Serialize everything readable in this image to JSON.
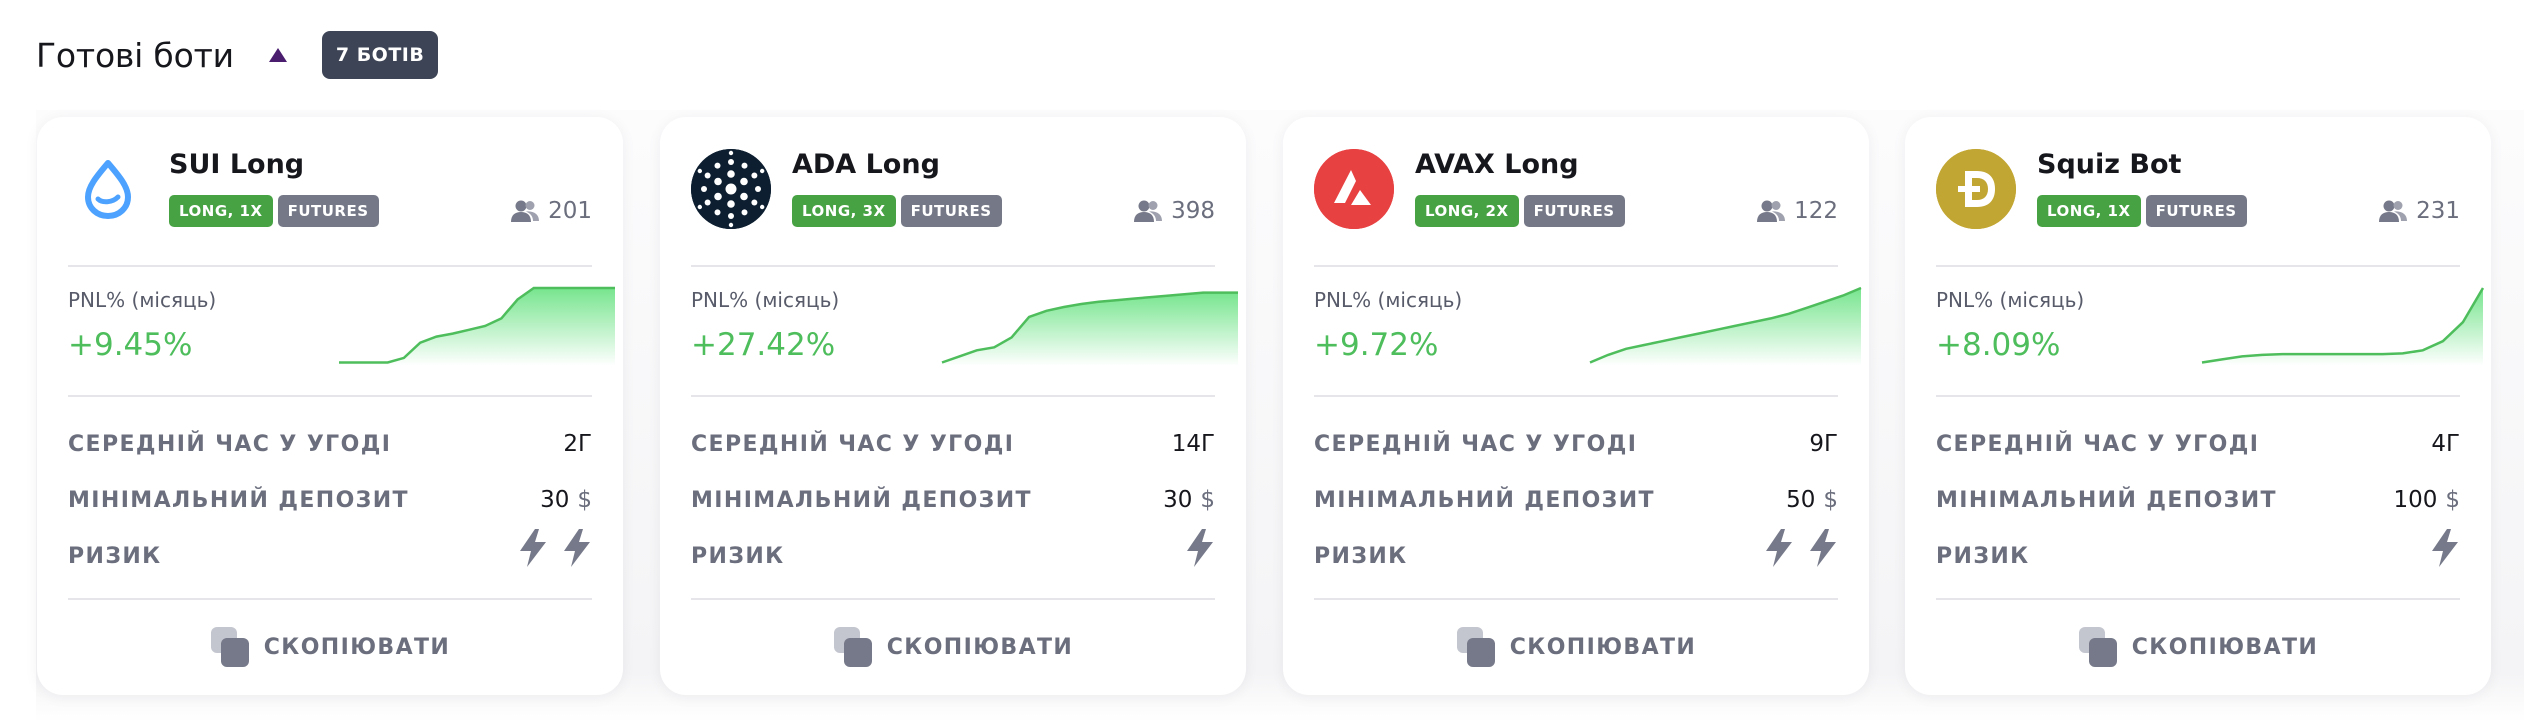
{
  "section": {
    "title": "Готові боти",
    "count_badge": "7 БОТІВ"
  },
  "labels": {
    "pnl": "PNL% (місяць)",
    "avg_time": "СЕРЕДНІЙ ЧАС У УГОДІ",
    "min_deposit": "МІНІМАЛЬНИЙ ДЕПОЗИТ",
    "risk": "РИЗИК",
    "copy": "СКОПІЮВАТИ",
    "currency": "$"
  },
  "colors": {
    "accent_green": "#4ebd5c",
    "leverage_tag": "#47a243",
    "market_tag": "#757887",
    "badge": "#3d4455",
    "sui": "#4da2ff",
    "ada": "#0d1e30",
    "avax": "#e84142",
    "doge": "#c2a633"
  },
  "bots": [
    {
      "name": "SUI Long",
      "icon": "sui-icon",
      "leverage": "LONG, 1X",
      "market": "FUTURES",
      "users": "201",
      "pnl": "+9.45%",
      "avg_time": "2Г",
      "min_deposit": "30",
      "risk": 2,
      "spark": [
        0.02,
        0.02,
        0.02,
        0.02,
        0.08,
        0.28,
        0.36,
        0.4,
        0.45,
        0.5,
        0.6,
        0.85,
        1,
        1,
        1,
        1,
        1,
        1
      ]
    },
    {
      "name": "ADA Long",
      "icon": "ada-icon",
      "leverage": "LONG, 3X",
      "market": "FUTURES",
      "users": "398",
      "pnl": "+27.42%",
      "avg_time": "14Г",
      "min_deposit": "30",
      "risk": 1,
      "spark": [
        0.02,
        0.1,
        0.18,
        0.22,
        0.35,
        0.62,
        0.7,
        0.75,
        0.79,
        0.82,
        0.84,
        0.86,
        0.88,
        0.9,
        0.92,
        0.94,
        0.94,
        0.94
      ]
    },
    {
      "name": "AVAX Long",
      "icon": "avax-icon",
      "leverage": "LONG, 2X",
      "market": "FUTURES",
      "users": "122",
      "pnl": "+9.72%",
      "avg_time": "9Г",
      "min_deposit": "50",
      "risk": 2,
      "spark": [
        0.02,
        0.12,
        0.2,
        0.25,
        0.3,
        0.35,
        0.4,
        0.45,
        0.5,
        0.55,
        0.6,
        0.66,
        0.74,
        0.82,
        0.9,
        1
      ]
    },
    {
      "name": "Squiz Bot",
      "icon": "doge-icon",
      "leverage": "LONG, 1X",
      "market": "FUTURES",
      "users": "231",
      "pnl": "+8.09%",
      "avg_time": "4Г",
      "min_deposit": "100",
      "risk": 1,
      "spark": [
        0.02,
        0.06,
        0.1,
        0.12,
        0.13,
        0.13,
        0.13,
        0.13,
        0.13,
        0.13,
        0.14,
        0.18,
        0.3,
        0.55,
        1
      ]
    }
  ]
}
